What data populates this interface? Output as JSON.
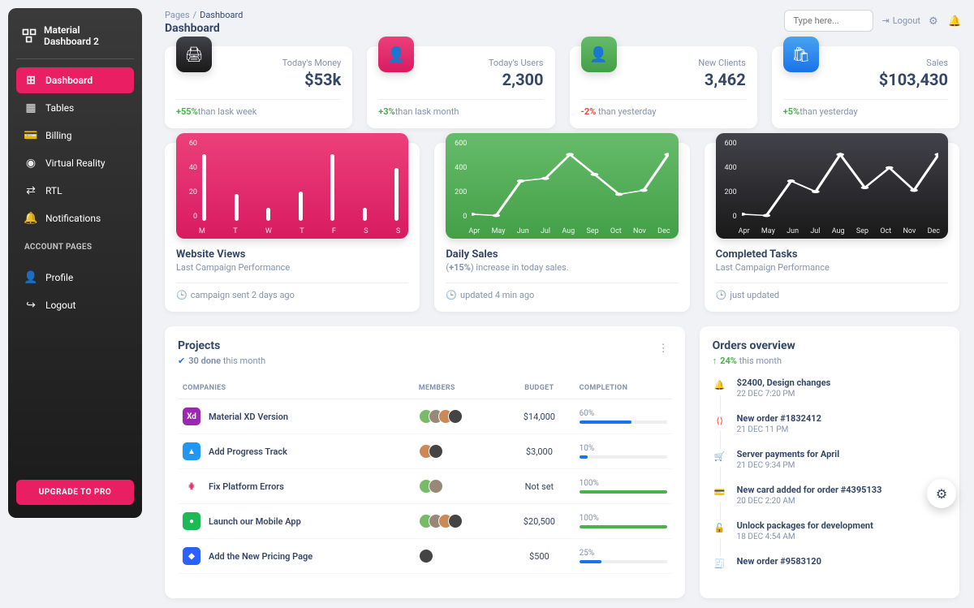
{
  "brand": "Material Dashboard 2",
  "sidebar": {
    "items": [
      {
        "label": "Dashboard",
        "icon": "⊞",
        "active": true
      },
      {
        "label": "Tables",
        "icon": "▦"
      },
      {
        "label": "Billing",
        "icon": "💳"
      },
      {
        "label": "Virtual Reality",
        "icon": "◉"
      },
      {
        "label": "RTL",
        "icon": "⇄"
      },
      {
        "label": "Notifications",
        "icon": "🔔"
      }
    ],
    "account_section": "ACCOUNT PAGES",
    "account_items": [
      {
        "label": "Profile",
        "icon": "👤"
      },
      {
        "label": "Logout",
        "icon": "↪"
      }
    ],
    "upgrade": "UPGRADE TO PRO"
  },
  "breadcrumb": {
    "root": "Pages",
    "sep": "/",
    "current": "Dashboard"
  },
  "page_title": "Dashboard",
  "search": {
    "placeholder": "Type here..."
  },
  "topbar": {
    "logout": "Logout"
  },
  "stats": [
    {
      "icon_class": "icon-dark",
      "icon": "🖨",
      "label": "Today's Money",
      "value": "$53k",
      "pct": "+55%",
      "pct_class": "green",
      "suffix": "than lask week"
    },
    {
      "icon_class": "icon-pink",
      "icon": "👤",
      "label": "Today's Users",
      "value": "2,300",
      "pct": "+3%",
      "pct_class": "green",
      "suffix": "than lask month"
    },
    {
      "icon_class": "icon-green",
      "icon": "👤",
      "label": "New Clients",
      "value": "3,462",
      "pct": "-2%",
      "pct_class": "red",
      "suffix": " than yesterday"
    },
    {
      "icon_class": "icon-blue",
      "icon": "🛍",
      "label": "Sales",
      "value": "$103,430",
      "pct": "+5%",
      "pct_class": "green",
      "suffix": "than yesterday"
    }
  ],
  "charts": [
    {
      "bg": "bg-pink",
      "title": "Website Views",
      "sub": "Last Campaign Performance",
      "foot_icon": "🕒",
      "foot": "campaign sent 2 days ago",
      "y": [
        "60",
        "40",
        "20",
        "0"
      ],
      "x": [
        "M",
        "T",
        "W",
        "T",
        "F",
        "S",
        "S"
      ],
      "type": "bar"
    },
    {
      "bg": "bg-green",
      "title": "Daily Sales",
      "sub_html_prefix": "(",
      "sub_html_pct": "+15%",
      "sub_html_suffix": " increase in today sales.",
      "foot_icon": "🕒",
      "foot": "updated 4 min ago",
      "y": [
        "600",
        "400",
        "200",
        "0"
      ],
      "x": [
        "Apr",
        "May",
        "Jun",
        "Jul",
        "Aug",
        "Sep",
        "Oct",
        "Nov",
        "Dec"
      ],
      "type": "line"
    },
    {
      "bg": "bg-dark",
      "title": "Completed Tasks",
      "sub": "Last Campaign Performance",
      "foot_icon": "🕒",
      "foot": "just updated",
      "y": [
        "600",
        "400",
        "200",
        "0"
      ],
      "x": [
        "Apr",
        "May",
        "Jun",
        "Jul",
        "Aug",
        "Sep",
        "Oct",
        "Nov",
        "Dec"
      ],
      "type": "line"
    }
  ],
  "chart_data": [
    {
      "type": "bar",
      "title": "Website Views",
      "xlabel": "",
      "ylabel": "",
      "ylim": [
        0,
        60
      ],
      "categories": [
        "M",
        "T",
        "W",
        "T",
        "F",
        "S",
        "S"
      ],
      "values": [
        50,
        20,
        10,
        22,
        50,
        10,
        40
      ]
    },
    {
      "type": "line",
      "title": "Daily Sales",
      "xlabel": "",
      "ylabel": "",
      "ylim": [
        0,
        600
      ],
      "categories": [
        "Apr",
        "May",
        "Jun",
        "Jul",
        "Aug",
        "Sep",
        "Oct",
        "Nov",
        "Dec"
      ],
      "values": [
        50,
        40,
        300,
        320,
        500,
        350,
        200,
        230,
        500
      ]
    },
    {
      "type": "line",
      "title": "Completed Tasks",
      "xlabel": "",
      "ylabel": "",
      "ylim": [
        0,
        600
      ],
      "categories": [
        "Apr",
        "May",
        "Jun",
        "Jul",
        "Aug",
        "Sep",
        "Oct",
        "Nov",
        "Dec"
      ],
      "values": [
        50,
        40,
        300,
        220,
        500,
        250,
        400,
        230,
        500
      ]
    }
  ],
  "projects": {
    "title": "Projects",
    "sub_bold": "30 done",
    "sub_rest": " this month",
    "columns": [
      "COMPANIES",
      "MEMBERS",
      "BUDGET",
      "COMPLETION"
    ],
    "rows": [
      {
        "logo_bg": "#9c27b0",
        "logo_text": "Xd",
        "name": "Material XD Version",
        "members": [
          "#7b6",
          "#987",
          "#c85",
          "#444"
        ],
        "budget": "$14,000",
        "completion": 60,
        "bar_color": "#1a73e8"
      },
      {
        "logo_bg": "#2196f3",
        "logo_text": "▲",
        "name": "Add Progress Track",
        "members": [
          "#c85",
          "#444"
        ],
        "budget": "$3,000",
        "completion": 10,
        "bar_color": "#1a73e8"
      },
      {
        "logo_bg": "#fff",
        "logo_text": "⋕",
        "logo_fg": "#e01e5a",
        "name": "Fix Platform Errors",
        "members": [
          "#7b6",
          "#987"
        ],
        "budget": "Not set",
        "completion": 100,
        "bar_color": "#4caf50"
      },
      {
        "logo_bg": "#1db954",
        "logo_text": "●",
        "name": "Launch our Mobile App",
        "members": [
          "#7b6",
          "#987",
          "#c85",
          "#444"
        ],
        "budget": "$20,500",
        "completion": 100,
        "bar_color": "#4caf50"
      },
      {
        "logo_bg": "#2962ff",
        "logo_text": "◆",
        "name": "Add the New Pricing Page",
        "members": [
          "#444"
        ],
        "budget": "$500",
        "completion": 25,
        "bar_color": "#1a73e8"
      }
    ]
  },
  "orders": {
    "title": "Orders overview",
    "sub_icon": "↑",
    "sub_bold": "24%",
    "sub_rest": " this month",
    "items": [
      {
        "icon": "🔔",
        "color": "#4caf50",
        "title": "$2400, Design changes",
        "time": "22 DEC 7:20 PM"
      },
      {
        "icon": "⟨⟩",
        "color": "#f44336",
        "title": "New order #1832412",
        "time": "21 DEC 11 PM"
      },
      {
        "icon": "🛒",
        "color": "#1a73e8",
        "title": "Server payments for April",
        "time": "21 DEC 9:34 PM"
      },
      {
        "icon": "💳",
        "color": "#fb8c00",
        "title": "New card added for order #4395133",
        "time": "20 DEC 2:20 AM"
      },
      {
        "icon": "🔓",
        "color": "#e91e63",
        "title": "Unlock packages for development",
        "time": "18 DEC 4:54 AM"
      },
      {
        "icon": "🧾",
        "color": "#344767",
        "title": "New order #9583120",
        "time": ""
      }
    ]
  }
}
